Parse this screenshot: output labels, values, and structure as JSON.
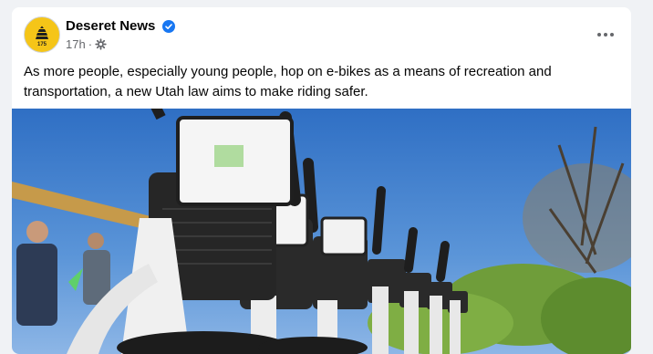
{
  "post": {
    "author": "Deseret News",
    "verified_icon": "verified-badge-icon",
    "timestamp": "17h",
    "separator": "·",
    "audience_icon": "public-gear-icon",
    "more_icon": "more-options-icon",
    "text": "As more people, especially young people, hop on e-bikes as a means of recreation and transportation, a new Utah law aims to make riding safer."
  },
  "avatar": {
    "logo_text": "175",
    "color": "#f5c518"
  },
  "colors": {
    "background": "#f0f2f5",
    "card": "#ffffff",
    "verified": "#1877f2",
    "sky": "#3f7fcf"
  }
}
